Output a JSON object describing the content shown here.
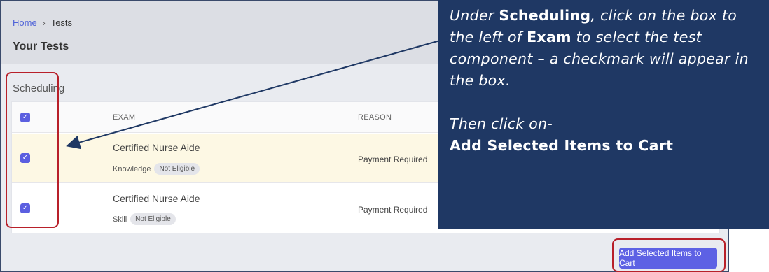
{
  "breadcrumb": {
    "home": "Home",
    "separator": "›",
    "current": "Tests"
  },
  "page_title": "Your Tests",
  "section": {
    "label": "Scheduling"
  },
  "table": {
    "columns": {
      "exam": "EXAM",
      "reason": "REASON"
    },
    "rows": [
      {
        "exam": "Certified Nurse Aide",
        "component": "Knowledge",
        "badge": "Not Eligible",
        "reason": "Payment Required",
        "checked": true
      },
      {
        "exam": "Certified Nurse Aide",
        "component": "Skill",
        "badge": "Not Eligible",
        "reason": "Payment Required",
        "checked": true
      }
    ],
    "header_checked": true
  },
  "cart_button": {
    "label": "Add Selected Items to Cart"
  },
  "callout": {
    "p1_a": "Under ",
    "p1_b": "Scheduling",
    "p1_c": ", click on the box to the left of ",
    "p1_d": "Exam",
    "p1_e": " to select the test component – a checkmark will appear in the box.",
    "p2_a": "Then click on-",
    "p2_b": "Add Selected Items to Cart"
  },
  "colors": {
    "callout_bg": "#1f3864",
    "accent": "#5d61e4",
    "highlight": "#b8202a",
    "row_highlight": "#fdf8e4"
  },
  "icons": {
    "checkbox": "check-icon",
    "separator": "chevron-right-icon"
  }
}
